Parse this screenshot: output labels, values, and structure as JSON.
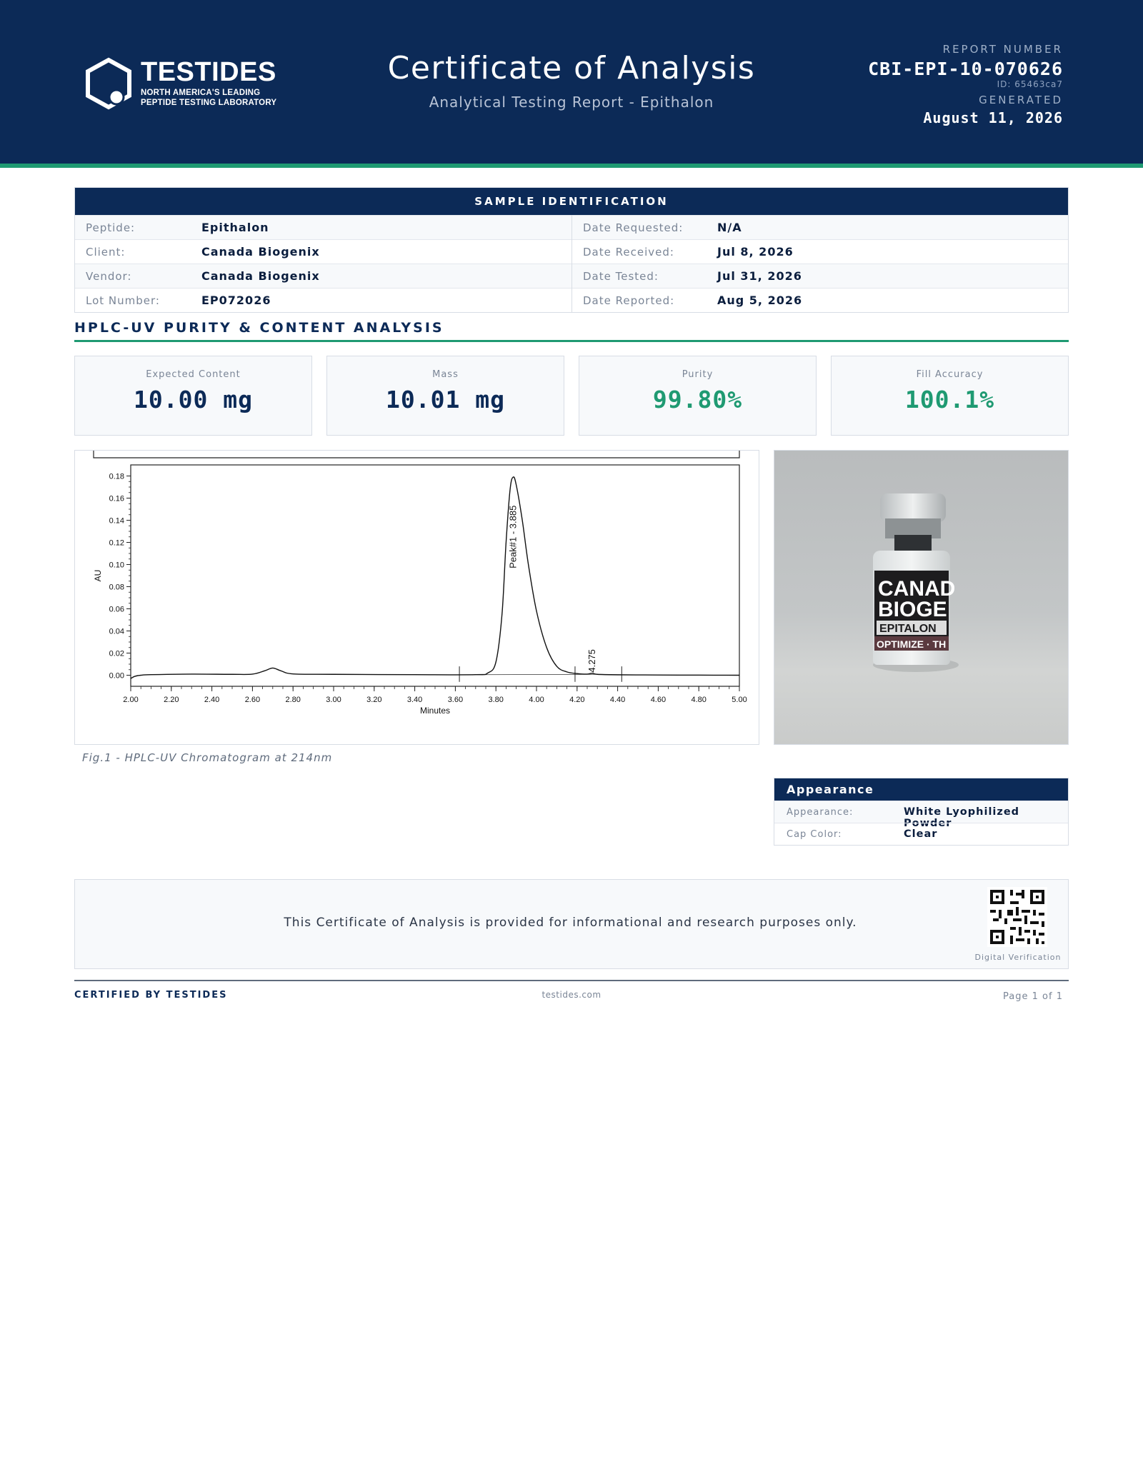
{
  "header": {
    "logo_name": "TESTIDES",
    "logo_tagline_1": "NORTH AMERICA'S LEADING",
    "logo_tagline_2": "PEPTIDE TESTING LABORATORY",
    "title": "Certificate of Analysis",
    "subtitle": "Analytical Testing Report - Epithalon",
    "report_number_label": "REPORT NUMBER",
    "report_number": "CBI-EPI-10-070626",
    "report_id": "ID: 65463ca7",
    "generated_label": "GENERATED",
    "generated_date": "August 11, 2026",
    "colors": {
      "navy": "#0c2a57",
      "accent_green": "#1f9a72"
    }
  },
  "sample_identification": {
    "title": "SAMPLE IDENTIFICATION",
    "left": [
      {
        "label": "Peptide:",
        "value": "Epithalon"
      },
      {
        "label": "Client:",
        "value": "Canada Biogenix"
      },
      {
        "label": "Vendor:",
        "value": "Canada Biogenix"
      },
      {
        "label": "Lot Number:",
        "value": "EP072026"
      }
    ],
    "right": [
      {
        "label": "Date Requested:",
        "value": "N/A"
      },
      {
        "label": "Date Received:",
        "value": "Jul 8, 2026"
      },
      {
        "label": "Date Tested:",
        "value": "Jul 31, 2026"
      },
      {
        "label": "Date Reported:",
        "value": "Aug 5, 2026"
      }
    ]
  },
  "analysis": {
    "section_title": "HPLC-UV PURITY & CONTENT ANALYSIS",
    "metrics": [
      {
        "label": "Expected Content",
        "value": "10.00 mg",
        "color": "navy"
      },
      {
        "label": "Mass",
        "value": "10.01 mg",
        "color": "navy"
      },
      {
        "label": "Purity",
        "value": "99.80%",
        "color": "green"
      },
      {
        "label": "Fill Accuracy",
        "value": "100.1%",
        "color": "green"
      }
    ],
    "figure_caption": "Fig.1 - HPLC-UV Chromatogram at 214nm"
  },
  "chart_data": {
    "type": "line",
    "title": "",
    "xlabel": "Minutes",
    "ylabel": "AU",
    "xlim": [
      2.0,
      5.0
    ],
    "ylim": [
      -0.01,
      0.19
    ],
    "x_ticks": [
      "2.00",
      "2.20",
      "2.40",
      "2.60",
      "2.80",
      "3.00",
      "3.20",
      "3.40",
      "3.60",
      "3.80",
      "4.00",
      "4.20",
      "4.40",
      "4.60",
      "4.80",
      "5.00"
    ],
    "y_ticks": [
      "0.00",
      "0.02",
      "0.04",
      "0.06",
      "0.08",
      "0.10",
      "0.12",
      "0.14",
      "0.16",
      "0.18"
    ],
    "series": [
      {
        "x": [
          2.0,
          2.02,
          2.05,
          2.1,
          2.3,
          2.5,
          2.6,
          2.66,
          2.7,
          2.74,
          2.8,
          3.0,
          3.4,
          3.7,
          3.76,
          3.8,
          3.83,
          3.85,
          3.87,
          3.885,
          3.9,
          3.93,
          3.96,
          4.0,
          4.05,
          4.1,
          4.15,
          4.2,
          4.25,
          4.275,
          4.3,
          4.4,
          4.6,
          4.8,
          5.0
        ],
        "y": [
          -0.003,
          -0.001,
          0.0,
          0.0005,
          0.001,
          0.0008,
          0.001,
          0.004,
          0.0065,
          0.004,
          0.0012,
          0.0008,
          0.0005,
          0.0005,
          0.002,
          0.012,
          0.055,
          0.12,
          0.168,
          0.179,
          0.172,
          0.14,
          0.1,
          0.058,
          0.025,
          0.008,
          0.003,
          0.0015,
          0.001,
          0.0018,
          0.0008,
          0.0004,
          0.0002,
          0.0001,
          0.0
        ]
      }
    ],
    "annotations": [
      {
        "x": 3.885,
        "y": 0.179,
        "text": "Peak#1 - 3.885"
      },
      {
        "x": 4.275,
        "y": 0.0018,
        "text": "4.275"
      }
    ],
    "integration_marks_x": [
      3.62,
      4.19,
      4.42
    ],
    "grid": false
  },
  "appearance": {
    "title": "Appearance",
    "rows": [
      {
        "label": "Appearance:",
        "value": "White Lyophilized Powder"
      },
      {
        "label": "Cap Color:",
        "value": "Clear"
      }
    ]
  },
  "photo": {
    "label_line1": "CANAD",
    "label_line2": "BIOGE",
    "label_band": "EPITALON",
    "label_bottom": "OPTIMIZE · TH"
  },
  "disclaimer": {
    "text": "This Certificate of Analysis is provided for informational and research purposes only.",
    "qr_label": "Digital Verification"
  },
  "footer": {
    "left": "CERTIFIED BY TESTIDES",
    "center": "testides.com",
    "right": "Page 1 of 1"
  }
}
